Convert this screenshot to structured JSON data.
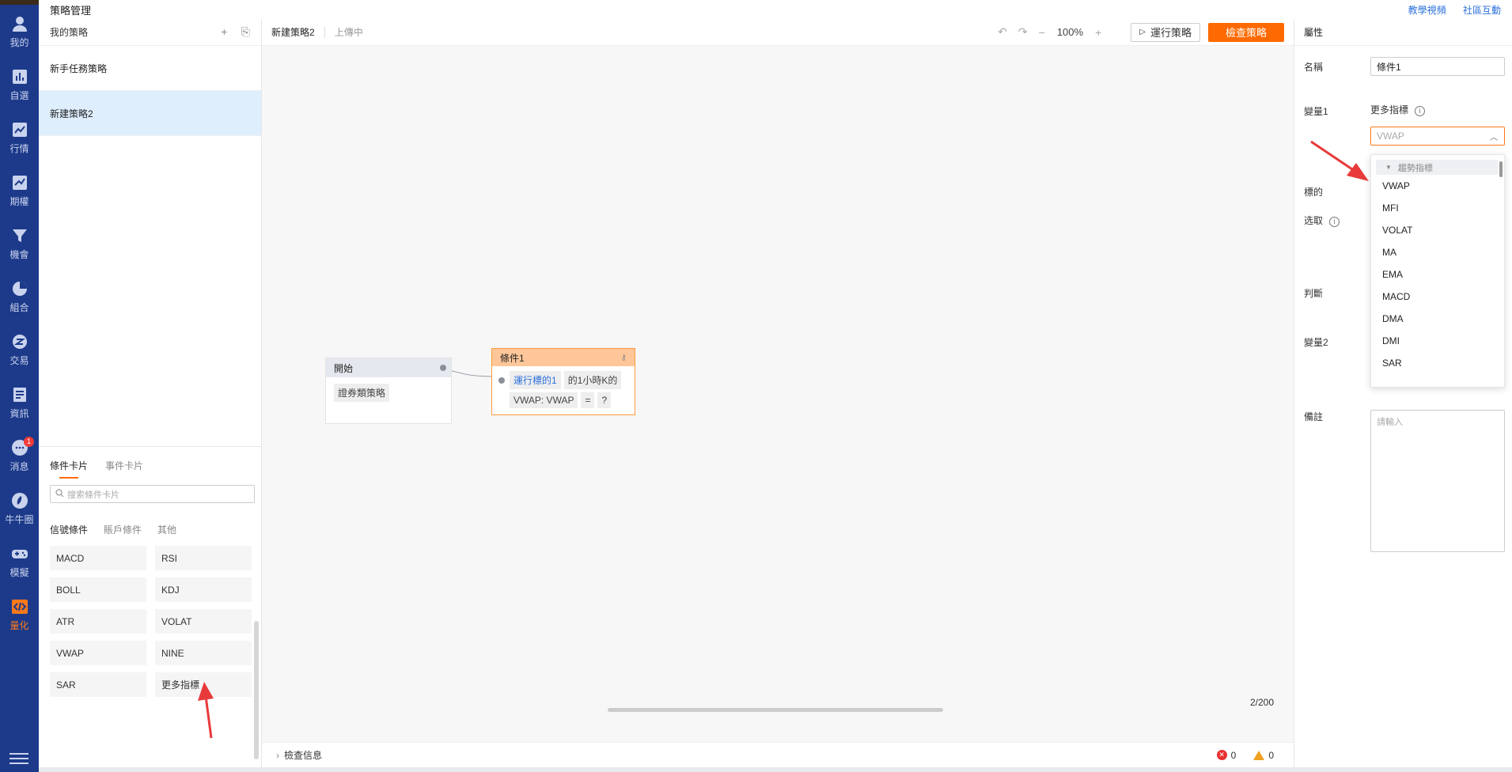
{
  "topbar": {
    "title": "策略管理",
    "links": [
      "教學視頻",
      "社區互動"
    ]
  },
  "nav": {
    "items": [
      {
        "label": "我的",
        "icon": "user-icon"
      },
      {
        "label": "自選",
        "icon": "bar-chart-icon"
      },
      {
        "label": "行情",
        "icon": "trend-icon"
      },
      {
        "label": "期權",
        "icon": "options-icon"
      },
      {
        "label": "機會",
        "icon": "funnel-icon"
      },
      {
        "label": "組合",
        "icon": "pie-icon"
      },
      {
        "label": "交易",
        "icon": "trade-icon"
      },
      {
        "label": "資訊",
        "icon": "news-icon"
      },
      {
        "label": "消息",
        "icon": "chat-icon",
        "badge": "1"
      },
      {
        "label": "牛牛圈",
        "icon": "community-icon"
      },
      {
        "label": "模擬",
        "icon": "gamepad-icon"
      },
      {
        "label": "量化",
        "icon": "code-icon",
        "active": true
      }
    ]
  },
  "strategies": {
    "header": "我的策略",
    "items": [
      "新手任務策略",
      "新建策略2"
    ],
    "selected_index": 1
  },
  "cards": {
    "tabs": [
      "條件卡片",
      "事件卡片"
    ],
    "search_placeholder": "搜索條件卡片",
    "subtabs": [
      "信號條件",
      "賬戶條件",
      "其他"
    ],
    "items": [
      "MACD",
      "RSI",
      "BOLL",
      "KDJ",
      "ATR",
      "VOLAT",
      "VWAP",
      "NINE",
      "SAR",
      "更多指標"
    ]
  },
  "canvas": {
    "name": "新建策略2",
    "status": "上傳中",
    "zoom": "100%",
    "run_label": "運行策略",
    "check_label": "檢查策略",
    "start_node": {
      "title": "開始",
      "chip": "證券類策略"
    },
    "cond_node": {
      "title": "條件1",
      "line1": [
        "運行標的1",
        "的1小時K的"
      ],
      "line2": [
        "VWAP: VWAP",
        "=",
        "?"
      ]
    },
    "counter": "2/200",
    "footer_label": "檢查信息",
    "errors": "0",
    "warnings": "0"
  },
  "props": {
    "header": "屬性",
    "name_label": "名稱",
    "name_value": "條件1",
    "var1_label": "變量1",
    "var1_more": "更多指標",
    "select_value": "VWAP",
    "target_label": "標的",
    "pick_label": "选取",
    "judge_label": "判斷",
    "var2_label": "變量2",
    "note_label": "備註",
    "note_placeholder": "請輸入",
    "dropdown": {
      "group": "趨勢指標",
      "options": [
        "VWAP",
        "MFI",
        "VOLAT",
        "MA",
        "EMA",
        "MACD",
        "DMA",
        "DMI",
        "SAR"
      ]
    }
  },
  "colors": {
    "nav_bg": "#1d3a8a",
    "accent": "#ff6a00",
    "link": "#2a6fdb",
    "annotation": "#e83a3a"
  }
}
